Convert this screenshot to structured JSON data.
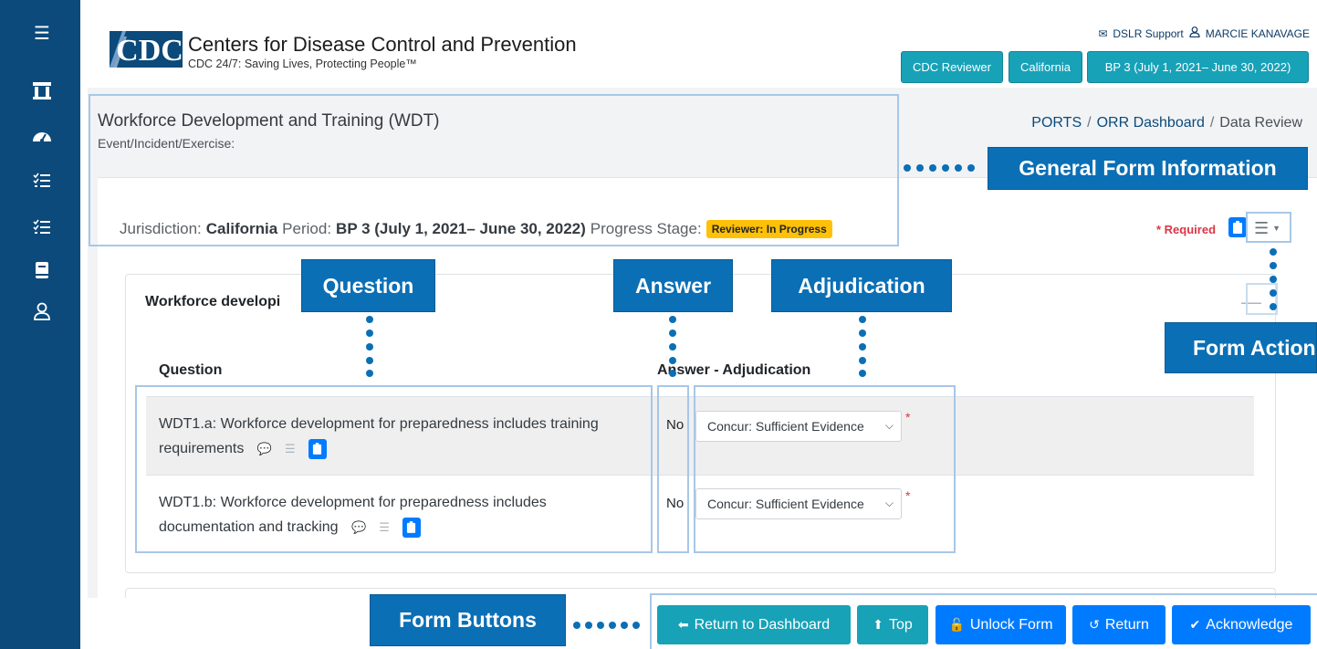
{
  "sidebar": {
    "icons": [
      "menu-icon",
      "institution-icon",
      "dashboard-icon",
      "checklist-icon",
      "checklist-icon",
      "book-icon",
      "user-icon"
    ]
  },
  "header": {
    "org_name": "Centers for Disease Control and Prevention",
    "tagline": "CDC 24/7: Saving Lives, Protecting People™",
    "support_link": "DSLR Support",
    "user_name": "MARCIE KANAVAGE",
    "role_button": "CDC Reviewer",
    "jurisdiction_button": "California",
    "period_button": "BP 3 (July 1, 2021– June 30, 2022)"
  },
  "page": {
    "title": "Workforce Development and Training (WDT)",
    "subtitle": "Event/Incident/Exercise:",
    "breadcrumb": [
      "PORTS",
      "ORR Dashboard",
      "Data Review"
    ]
  },
  "meta": {
    "jurisdiction_label": "Jurisdiction:",
    "jurisdiction_value": "California",
    "period_label": "Period:",
    "period_value": "BP 3 (July 1, 2021– June 30, 2022)",
    "stage_label": "Progress Stage:",
    "stage_value": "Reviewer: In Progress",
    "required_label": "* Required"
  },
  "section": {
    "title": "Workforce developi",
    "question_header": "Question",
    "answer_header": "Answer - Adjudication",
    "rows": [
      {
        "question": "WDT1.a: Workforce development for preparedness includes training requirements",
        "answer": "No",
        "adjudication": "Concur: Sufficient Evidence"
      },
      {
        "question": "WDT1.b: Workforce development for preparedness includes documentation and tracking",
        "answer": "No",
        "adjudication": "Concur: Sufficient Evidence"
      }
    ]
  },
  "footer": {
    "return_dashboard": "Return to Dashboard",
    "top": "Top",
    "unlock": "Unlock Form",
    "return": "Return",
    "acknowledge": "Acknowledge"
  },
  "annotations": {
    "general_form_info": "General Form Information",
    "question": "Question",
    "answer": "Answer",
    "adjudication": "Adjudication",
    "form_action": "Form Action",
    "form_buttons": "Form Buttons"
  },
  "colors": {
    "sidebar": "#0b4a7a",
    "teal_button": "#17a2b8",
    "blue_button": "#007bff",
    "annotation": "#0b6fb5",
    "badge": "#ffc107",
    "required": "#dc3545"
  }
}
